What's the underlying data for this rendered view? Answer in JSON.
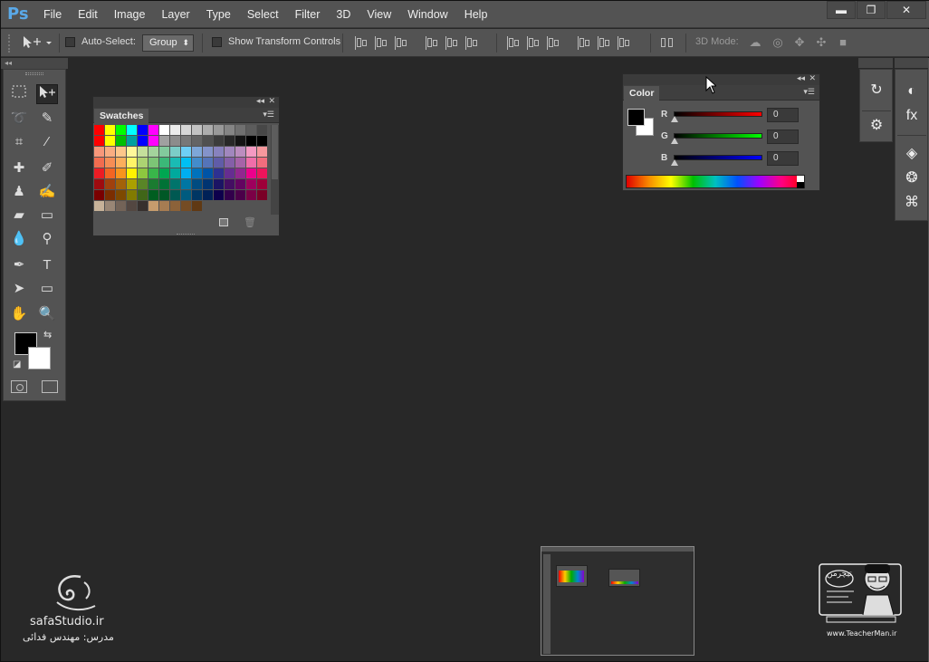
{
  "app": {
    "logo": "Ps"
  },
  "menu": [
    "File",
    "Edit",
    "Image",
    "Layer",
    "Type",
    "Select",
    "Filter",
    "3D",
    "View",
    "Window",
    "Help"
  ],
  "window_controls": {
    "minimize": "▬",
    "restore": "❐",
    "close": "✕"
  },
  "options_bar": {
    "auto_select_label": "Auto-Select:",
    "auto_select_checked": false,
    "auto_select_target": "Group",
    "show_transform_label": "Show Transform Controls",
    "show_transform_checked": false,
    "mode_3d_label": "3D Mode:"
  },
  "swatches_panel": {
    "tab_label": "Swatches",
    "colors": [
      [
        "#ff0000",
        "#ffff00",
        "#00ff00",
        "#00ffff",
        "#0000ff",
        "#ff00ff",
        "#ffffff",
        "#ebebeb",
        "#d6d6d6",
        "#c2c2c2",
        "#adadad",
        "#999999",
        "#858585",
        "#707070",
        "#5c5c5c",
        "#474747"
      ],
      [
        "#ff0000",
        "#ffff00",
        "#00c000",
        "#00a0a0",
        "#0000ff",
        "#ff00ff",
        "#a0a0a0",
        "#8c8c8c",
        "#787878",
        "#646464",
        "#505050",
        "#3c3c3c",
        "#282828",
        "#141414",
        "#000000",
        "#000000"
      ],
      [
        "#f7977a",
        "#f9ad81",
        "#fdc68a",
        "#fff79a",
        "#c4df9b",
        "#a3d39c",
        "#82ca9d",
        "#7bcdc8",
        "#6ecff6",
        "#7ea7d8",
        "#8493ca",
        "#8882be",
        "#a187be",
        "#bc8dbf",
        "#f49ac2",
        "#f6989d"
      ],
      [
        "#f26c4f",
        "#f68e55",
        "#fbaf5c",
        "#fff467",
        "#acd372",
        "#7cc576",
        "#3bb878",
        "#1abbb4",
        "#00bff3",
        "#438ccb",
        "#5574b9",
        "#605ca8",
        "#855fa8",
        "#a763a8",
        "#f06ea9",
        "#f26d7d"
      ],
      [
        "#ed1c24",
        "#f26522",
        "#f7941d",
        "#fff200",
        "#8dc73f",
        "#39b54a",
        "#00a651",
        "#00a99d",
        "#00aeef",
        "#0072bc",
        "#0054a6",
        "#2e3192",
        "#662d91",
        "#92278f",
        "#ec008c",
        "#ed145b"
      ],
      [
        "#9e0b0f",
        "#a0410d",
        "#a36209",
        "#aba000",
        "#598527",
        "#1a7b30",
        "#007236",
        "#00746b",
        "#0076a3",
        "#004b80",
        "#003471",
        "#1b1464",
        "#440e62",
        "#630460",
        "#9e005d",
        "#9e0039"
      ],
      [
        "#790000",
        "#7b2e00",
        "#7d4900",
        "#827b00",
        "#406618",
        "#005e20",
        "#005826",
        "#005952",
        "#005b7f",
        "#003663",
        "#002157",
        "#0d004c",
        "#32004b",
        "#4b0049",
        "#7b0046",
        "#7a0026"
      ],
      [
        "#c7b299",
        "#998675",
        "#736357",
        "#534741",
        "#37302d",
        "#c69c6d",
        "#a67c52",
        "#8c6239",
        "#754c24",
        "#603913",
        "#535353",
        "#535353",
        "#535353",
        "#535353",
        "#535353",
        "#535353"
      ]
    ]
  },
  "color_panel": {
    "tab_label": "Color",
    "channels": [
      {
        "label": "R",
        "value": "0",
        "gradient": "linear-gradient(to right,#000,#ff0000)"
      },
      {
        "label": "G",
        "value": "0",
        "gradient": "linear-gradient(to right,#000,#00ff00)"
      },
      {
        "label": "B",
        "value": "0",
        "gradient": "linear-gradient(to right,#000,#0000ff)"
      }
    ]
  },
  "watermark_left": {
    "site": "safaStudio.ir",
    "teacher": "مدرس: مهندس فدائی"
  },
  "watermark_right": {
    "logo": "تیچرمن",
    "site": "www.TeacherMan.ir"
  }
}
